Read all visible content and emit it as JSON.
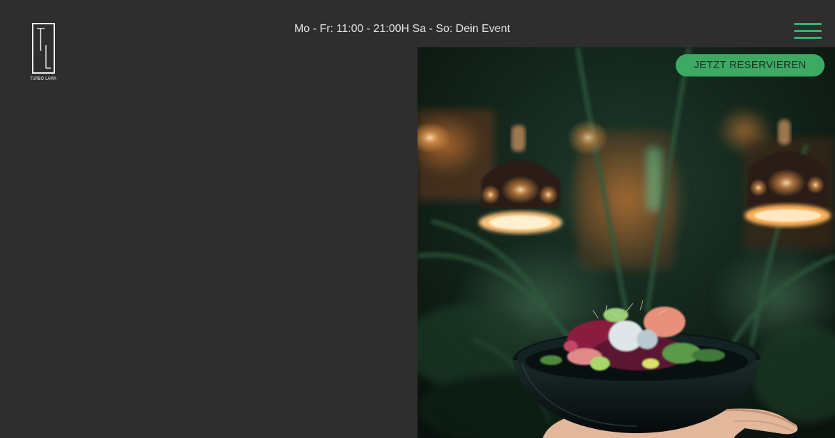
{
  "brand": {
    "logo_monogram": "TL",
    "logo_text": "TURBO LAMA"
  },
  "header": {
    "hours": "Mo - Fr: 11:00 - 21:00H Sa - So: Dein Event",
    "menu_icon": "hamburger-icon"
  },
  "cta": {
    "reserve_label": "JETZT RESERVIEREN"
  },
  "hero": {
    "image": "restaurant-dish-photo"
  },
  "colors": {
    "background": "#2e2e2e",
    "accent": "#3daa64",
    "text": "#e6e6e6"
  }
}
